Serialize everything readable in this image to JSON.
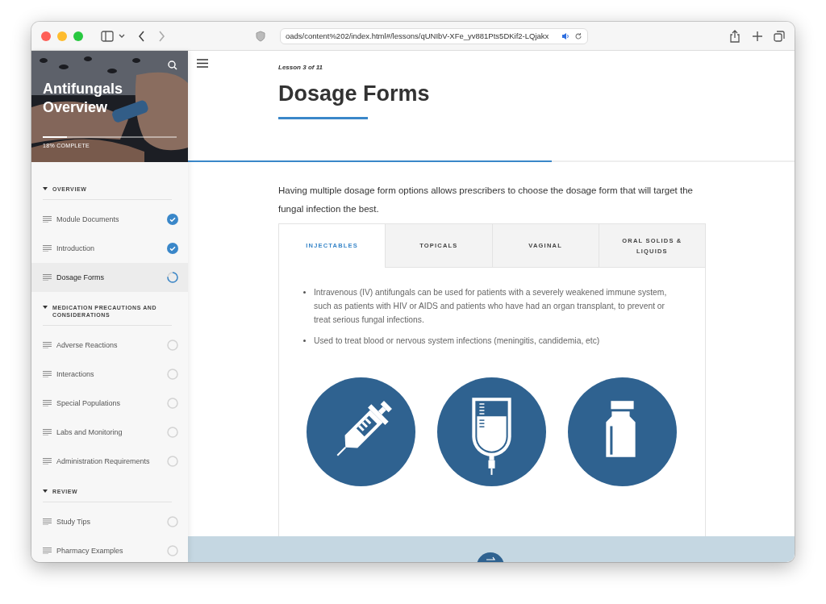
{
  "browser": {
    "url": "oads/content%202/index.html#/lessons/qUNIbV-XFe_yv881Pts5DKif2-LQjakx"
  },
  "course": {
    "title": "Antifungals Overview",
    "progress": {
      "label": "18% COMPLETE",
      "level": 0.18
    }
  },
  "sections": [
    {
      "title": "OVERVIEW",
      "expanded": true,
      "lessons": [
        {
          "label": "Module Documents",
          "kind": "complete",
          "selected": false
        },
        {
          "label": "Introduction",
          "kind": "complete",
          "selected": false
        },
        {
          "label": "Dosage Forms",
          "kind": "started",
          "selected": true
        }
      ]
    },
    {
      "title": "MEDICATION PRECAUTIONS AND CONSIDERATIONS",
      "expanded": true,
      "lessons": [
        {
          "label": "Adverse Reactions",
          "kind": "unstarted",
          "selected": false
        },
        {
          "label": "Interactions",
          "kind": "unstarted",
          "selected": false
        },
        {
          "label": "Special Populations",
          "kind": "unstarted",
          "selected": false
        },
        {
          "label": "Labs and Monitoring",
          "kind": "unstarted",
          "selected": false
        },
        {
          "label": "Administration Requirements",
          "kind": "unstarted",
          "selected": false
        }
      ]
    },
    {
      "title": "REVIEW",
      "expanded": true,
      "lessons": [
        {
          "label": "Study Tips",
          "kind": "unstarted",
          "selected": false
        },
        {
          "label": "Pharmacy Examples",
          "kind": "unstarted",
          "selected": false
        }
      ]
    }
  ],
  "lesson": {
    "counter": "Lesson 3 of 11",
    "title": "Dosage Forms",
    "scroll_progress": {
      "level": 0.6
    },
    "intro": "Having multiple dosage form options allows prescribers to choose the dosage form that will target the fungal infection the best.",
    "tabs": [
      {
        "label": "INJECTABLES",
        "selected": true
      },
      {
        "label": "TOPICALS",
        "selected": false
      },
      {
        "label": "VAGINAL",
        "selected": false
      },
      {
        "label": "ORAL SOLIDS & LIQUIDS",
        "selected": false
      }
    ],
    "bullets": [
      "Intravenous (IV) antifungals can be used for patients with a severely weakened immune system, such as patients with HIV or AIDS and patients who have had an organ transplant, to prevent or treat serious fungal infections.",
      "Used to treat blood or nervous system infections (meningitis, candidemia, etc)"
    ]
  }
}
